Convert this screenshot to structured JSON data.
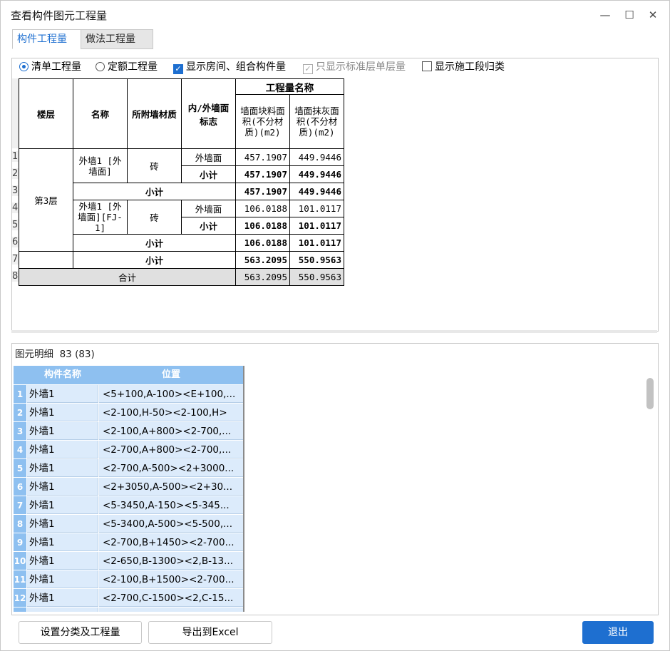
{
  "window": {
    "title": "查看构件图元工程量",
    "minimize": "—",
    "maximize": "☐",
    "close": "✕"
  },
  "tabs": [
    "构件工程量",
    "做法工程量"
  ],
  "options": {
    "radio_list": "清单工程量",
    "radio_quota": "定额工程量",
    "chk_rooms": "显示房间、组合构件量",
    "chk_std": "只显示标准层单层量",
    "chk_section": "显示施工段归类"
  },
  "quantity_table": {
    "headers": {
      "floor": "楼层",
      "name": "名称",
      "material": "所附墙材质",
      "inout": "内/外墙面标志",
      "group": "工程量名称",
      "col_block": "墙面块料面积(不分材质)(m2)",
      "col_plaster": "墙面抹灰面积(不分材质)(m2)"
    },
    "row_numbers": [
      "1",
      "2",
      "3",
      "4",
      "5",
      "6",
      "7",
      "8"
    ],
    "floor": "第3层",
    "name1": "外墙1 [外墙面]",
    "name2": "外墙1 [外墙面][FJ-1]",
    "material": "砖",
    "outer": "外墙面",
    "subtotal": "小计",
    "total": "合计",
    "v": {
      "r1a": "457.1907",
      "r1b": "449.9446",
      "r2a": "457.1907",
      "r2b": "449.9446",
      "r3a": "457.1907",
      "r3b": "449.9446",
      "r4a": "106.0188",
      "r4b": "101.0117",
      "r5a": "106.0188",
      "r5b": "101.0117",
      "r6a": "106.0188",
      "r6b": "101.0117",
      "r7a": "563.2095",
      "r7b": "550.9563",
      "r8a": "563.2095",
      "r8b": "550.9563"
    }
  },
  "detail": {
    "title": "图元明细",
    "count": "83 (83)",
    "col_name": "构件名称",
    "col_pos": "位置",
    "rows": [
      {
        "n": "1",
        "name": "外墙1",
        "pos": "<5+100,A-100><E+100,..."
      },
      {
        "n": "2",
        "name": "外墙1",
        "pos": "<2-100,H-50><2-100,H>"
      },
      {
        "n": "3",
        "name": "外墙1",
        "pos": "<2-100,A+800><2-700,..."
      },
      {
        "n": "4",
        "name": "外墙1",
        "pos": "<2-700,A+800><2-700,..."
      },
      {
        "n": "5",
        "name": "外墙1",
        "pos": "<2-700,A-500><2+3000..."
      },
      {
        "n": "6",
        "name": "外墙1",
        "pos": "<2+3050,A-500><2+30..."
      },
      {
        "n": "7",
        "name": "外墙1",
        "pos": "<5-3450,A-150><5-345..."
      },
      {
        "n": "8",
        "name": "外墙1",
        "pos": "<5-3400,A-500><5-500,..."
      },
      {
        "n": "9",
        "name": "外墙1",
        "pos": "<2-700,B+1450><2-700..."
      },
      {
        "n": "10",
        "name": "外墙1",
        "pos": "<2-650,B-1300><2,B-13..."
      },
      {
        "n": "11",
        "name": "外墙1",
        "pos": "<2-100,B+1500><2-700..."
      },
      {
        "n": "12",
        "name": "外墙1",
        "pos": "<2-700,C-1500><2,C-15..."
      }
    ]
  },
  "buttons": {
    "set_category": "设置分类及工程量",
    "export": "导出到Excel",
    "exit": "退出"
  },
  "colors": {
    "accent": "#1e6fd0",
    "grid_header": "#8ec0f0",
    "grid_cell": "#dcebfb"
  }
}
